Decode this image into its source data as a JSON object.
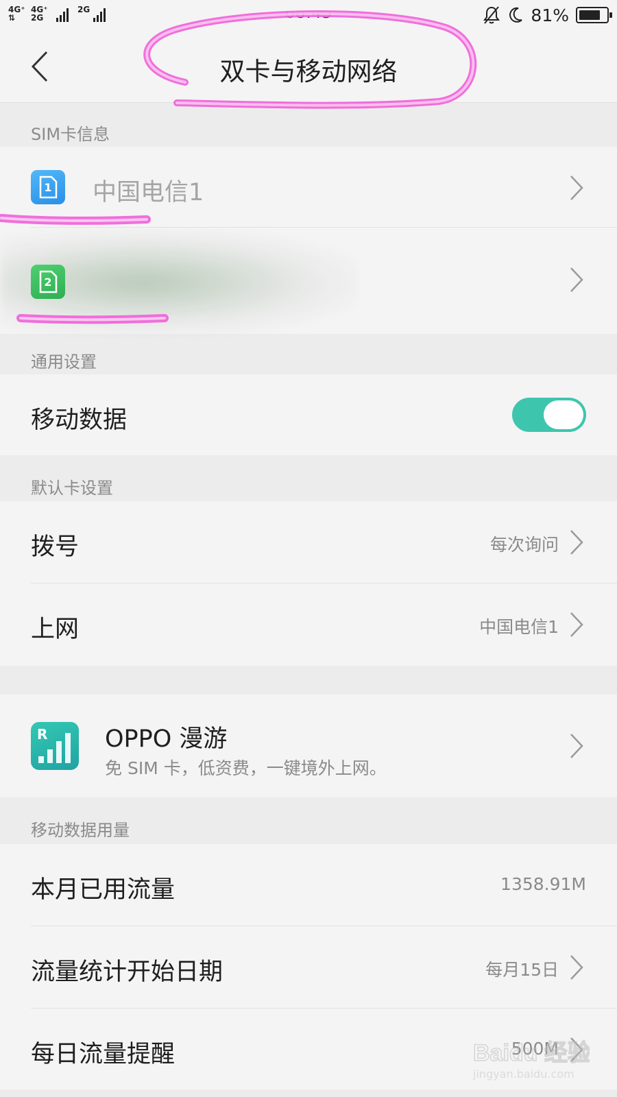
{
  "status_bar": {
    "network_1": "4G⁺ ⇅",
    "network_2": "4G⁺ 2G",
    "network_3": "2G",
    "time": "08:45",
    "battery_text": "81%",
    "battery_level": 0.81
  },
  "header": {
    "title": "双卡与移动网络"
  },
  "sim_info": {
    "section_label": "SIM卡信息",
    "sim1_name": "中国电信1",
    "sim1_badge": "1",
    "sim2_badge": "2"
  },
  "general": {
    "section_label": "通用设置",
    "mobile_data_label": "移动数据",
    "mobile_data_on": true
  },
  "default_card": {
    "section_label": "默认卡设置",
    "dial_label": "拨号",
    "dial_value": "每次询问",
    "internet_label": "上网",
    "internet_value": "中国电信1"
  },
  "roaming": {
    "title": "OPPO 漫游",
    "subtitle": "免 SIM 卡，低资费，一键境外上网。",
    "icon_letter": "R"
  },
  "usage": {
    "section_label": "移动数据用量",
    "month_used_label": "本月已用流量",
    "month_used_value": "1358.91M",
    "start_date_label": "流量统计开始日期",
    "start_date_value": "每月15日",
    "daily_alert_label": "每日流量提醒",
    "daily_alert_value": "500M"
  },
  "watermark": {
    "brand": "Baidu 经验",
    "url": "jingyan.baidu.com"
  },
  "colors": {
    "accent": "#3ec5ae",
    "scribble": "#f060d8",
    "sim1": "#3aa6f2",
    "sim2": "#38b85a"
  }
}
